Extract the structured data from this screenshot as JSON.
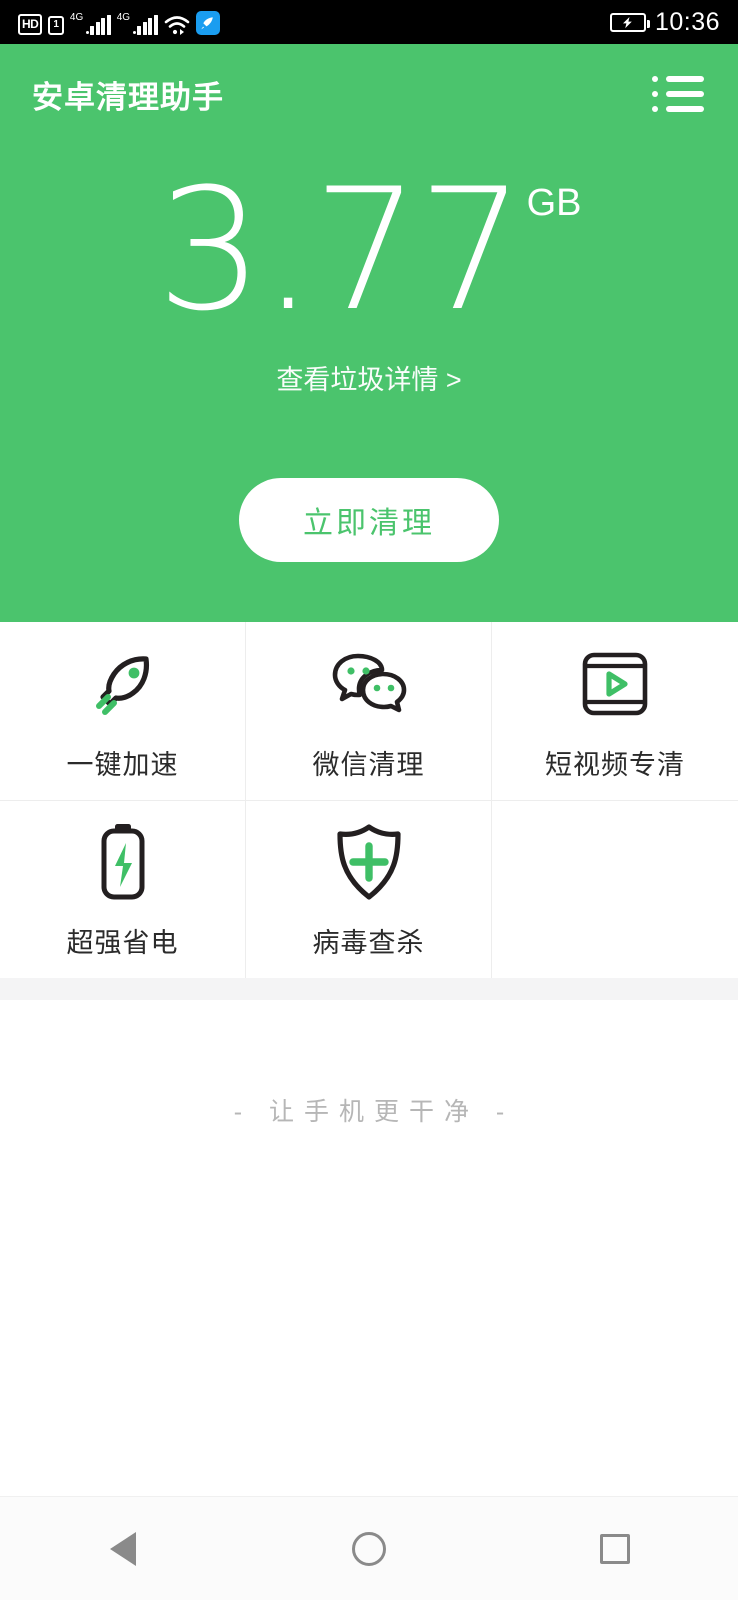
{
  "status_bar": {
    "hd_label": "HD",
    "sim_label": "1",
    "network_label_1": "4G",
    "network_label_2": "4G",
    "wifi_icon": "wifi-icon",
    "accelerator_icon": "rocket-speed-icon",
    "battery_icon": "battery-charging-icon",
    "time": "10:36",
    "background_color": "#000000"
  },
  "header": {
    "title": "安卓清理助手",
    "menu_icon": "list-menu-icon",
    "background_color": "#4bc46d"
  },
  "hero": {
    "junk_size": "3.77",
    "junk_unit": "GB",
    "detail_link": "查看垃圾详情 >",
    "clean_button": "立即清理",
    "button_text_color": "#4bc46d"
  },
  "features": [
    {
      "label": "一键加速",
      "icon": "rocket-icon",
      "accent": "#3fbf66"
    },
    {
      "label": "微信清理",
      "icon": "wechat-icon",
      "accent": "#3fbf66"
    },
    {
      "label": "短视频专清",
      "icon": "video-play-icon",
      "accent": "#3fbf66"
    },
    {
      "label": "超强省电",
      "icon": "battery-bolt-icon",
      "accent": "#3fbf66"
    },
    {
      "label": "病毒查杀",
      "icon": "shield-plus-icon",
      "accent": "#3fbf66"
    }
  ],
  "footer": {
    "slogan": "- 让手机更干净 -"
  },
  "nav_bar": {
    "back_icon": "back-triangle-icon",
    "home_icon": "home-circle-icon",
    "recents_icon": "recents-square-icon"
  }
}
